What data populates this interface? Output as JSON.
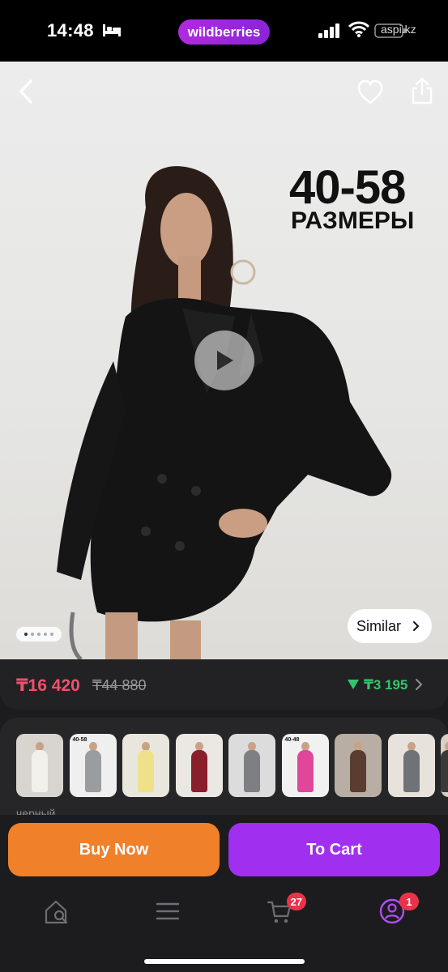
{
  "status_bar": {
    "time": "14:48",
    "brand": "wildberries",
    "watermark": "aspi.kz"
  },
  "product_image": {
    "size_range": "40-58",
    "size_label": "РАЗМЕРЫ",
    "gallery_dots": 5,
    "active_dot": 1,
    "similar_label": "Similar"
  },
  "price_bar": {
    "price": "₸16 420",
    "old_price": "₸44 880",
    "delta_price": "₸3 195"
  },
  "variants": {
    "color_name": "черный",
    "items": [
      {
        "name": "white",
        "bg": "#d8d4cf",
        "color": "#f2f0ea"
      },
      {
        "name": "gray-check",
        "bg": "#efefef",
        "color": "#9a9ca0",
        "label": "40-58"
      },
      {
        "name": "yellow",
        "bg": "#e9e6de",
        "color": "#efe08a"
      },
      {
        "name": "burgundy",
        "bg": "#ebe7e3",
        "color": "#8a1f2c"
      },
      {
        "name": "gray",
        "bg": "#dcdcdc",
        "color": "#7d7f83"
      },
      {
        "name": "pink",
        "bg": "#f1f1f1",
        "color": "#e0469a",
        "label": "40-48"
      },
      {
        "name": "brown",
        "bg": "#b8aea4",
        "color": "#5a3c30"
      },
      {
        "name": "gray-jacket",
        "bg": "#e7e3dc",
        "color": "#6f7378"
      },
      {
        "name": "partial",
        "bg": "#d9d0c6",
        "color": "#3a3a3a"
      }
    ]
  },
  "actions": {
    "buy_now": "Buy Now",
    "to_cart": "To Cart"
  },
  "tab_bar": {
    "cart_count": "27",
    "profile_count": "1"
  },
  "colors": {
    "price": "#f0506e",
    "buy": "#f0802a",
    "cart": "#a12ff0",
    "badge": "#e8334a",
    "delta": "#35c46a"
  }
}
